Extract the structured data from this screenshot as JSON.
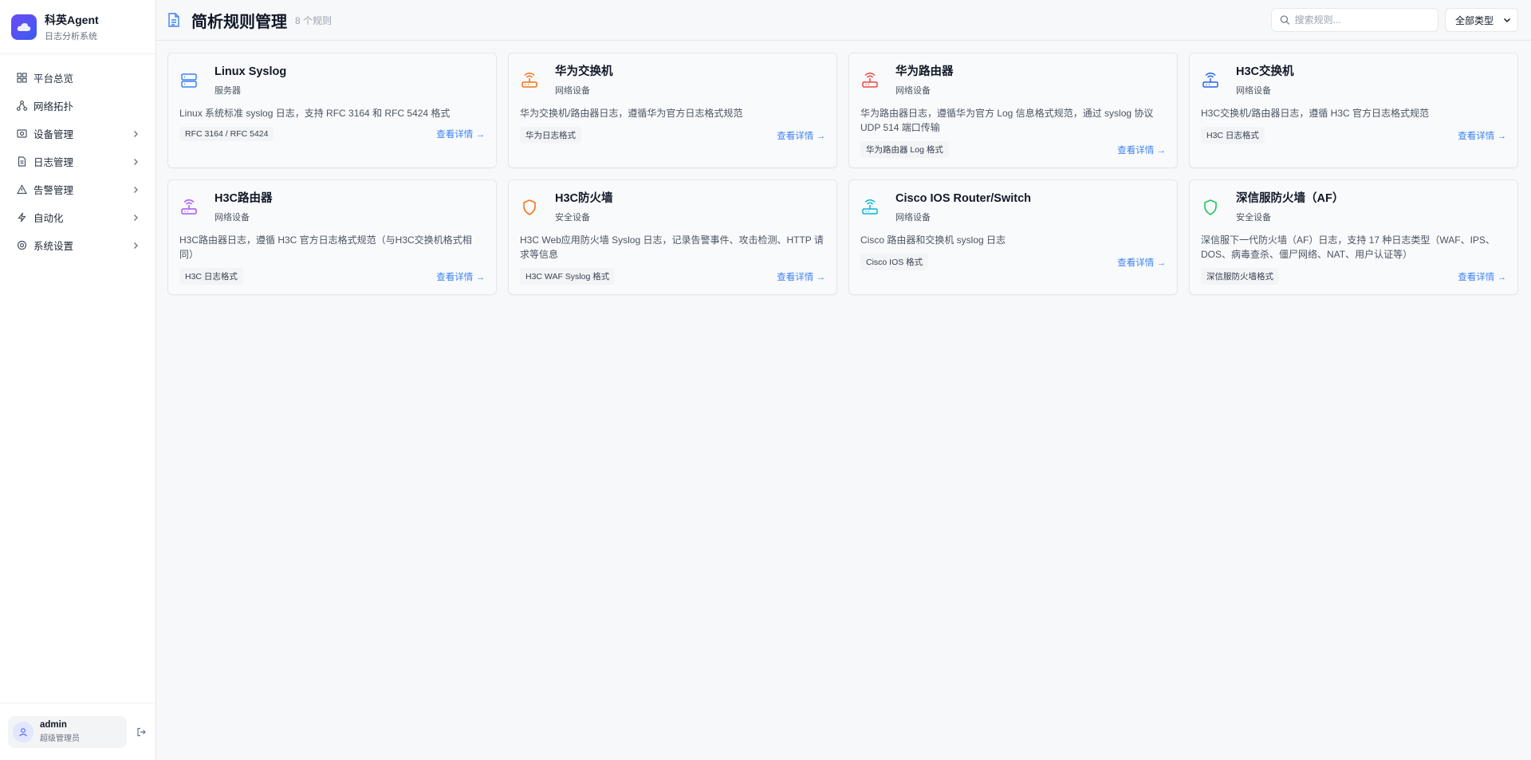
{
  "brand": {
    "name": "科英Agent",
    "subtitle": "日志分析系统",
    "logo_icon": "cloud-icon",
    "gradient": [
      "#6d4cf5",
      "#3b5bf0"
    ]
  },
  "nav": [
    {
      "label": "平台总览",
      "icon": "dashboard-grid-icon",
      "has_children": false
    },
    {
      "label": "网络拓扑",
      "icon": "network-topology-icon",
      "has_children": false
    },
    {
      "label": "设备管理",
      "icon": "device-icon",
      "has_children": true
    },
    {
      "label": "日志管理",
      "icon": "document-icon",
      "has_children": true
    },
    {
      "label": "告警管理",
      "icon": "alert-triangle-icon",
      "has_children": true
    },
    {
      "label": "自动化",
      "icon": "lightning-icon",
      "has_children": true
    },
    {
      "label": "系统设置",
      "icon": "gear-icon",
      "has_children": true
    }
  ],
  "user": {
    "name": "admin",
    "role": "超级管理员"
  },
  "header": {
    "title": "简析规则管理",
    "count": "8 个规则",
    "search_placeholder": "搜索规则...",
    "type_filter": "全部类型"
  },
  "colors": {
    "accent": "#3b82f6",
    "page_bg": "#f7f8fa"
  },
  "rules": [
    {
      "title": "Linux Syslog",
      "type": "服务器",
      "desc": "Linux 系统标准 syslog 日志，支持 RFC 3164 和 RFC 5424 格式",
      "tag": "RFC 3164 / RFC 5424",
      "link": "查看详情 →",
      "icon": "server-icon",
      "icon_color": "#3b82f6"
    },
    {
      "title": "华为交换机",
      "type": "网络设备",
      "desc": "华为交换机/路由器日志，遵循华为官方日志格式规范",
      "tag": "华为日志格式",
      "link": "查看详情 →",
      "icon": "router-wifi-icon",
      "icon_color": "#f97316"
    },
    {
      "title": "华为路由器",
      "type": "网络设备",
      "desc": "华为路由器日志，遵循华为官方 Log 信息格式规范，通过 syslog 协议 UDP 514 端口传输",
      "tag": "华为路由器 Log 格式",
      "link": "查看详情 →",
      "icon": "router-wifi-icon",
      "icon_color": "#ef4444"
    },
    {
      "title": "H3C交换机",
      "type": "网络设备",
      "desc": "H3C交换机/路由器日志，遵循 H3C 官方日志格式规范",
      "tag": "H3C 日志格式",
      "link": "查看详情 →",
      "icon": "router-wifi-icon",
      "icon_color": "#2563eb"
    },
    {
      "title": "H3C路由器",
      "type": "网络设备",
      "desc": "H3C路由器日志，遵循 H3C 官方日志格式规范（与H3C交换机格式相同）",
      "tag": "H3C 日志格式",
      "link": "查看详情 →",
      "icon": "router-wifi-icon",
      "icon_color": "#a855f7"
    },
    {
      "title": "H3C防火墙",
      "type": "安全设备",
      "desc": "H3C Web应用防火墙 Syslog 日志，记录告警事件、攻击检测、HTTP 请求等信息",
      "tag": "H3C WAF Syslog 格式",
      "link": "查看详情 →",
      "icon": "shield-icon",
      "icon_color": "#f97316"
    },
    {
      "title": "Cisco IOS Router/Switch",
      "type": "网络设备",
      "desc": "Cisco 路由器和交换机 syslog 日志",
      "tag": "Cisco IOS 格式",
      "link": "查看详情 →",
      "icon": "router-wifi-icon",
      "icon_color": "#06b6d4"
    },
    {
      "title": "深信服防火墙（AF）",
      "type": "安全设备",
      "desc": "深信服下一代防火墙（AF）日志，支持 17 种日志类型（WAF、IPS、DOS、病毒查杀、僵尸网络、NAT、用户认证等）",
      "tag": "深信服防火墙格式",
      "link": "查看详情 →",
      "icon": "shield-icon",
      "icon_color": "#22c55e"
    }
  ]
}
